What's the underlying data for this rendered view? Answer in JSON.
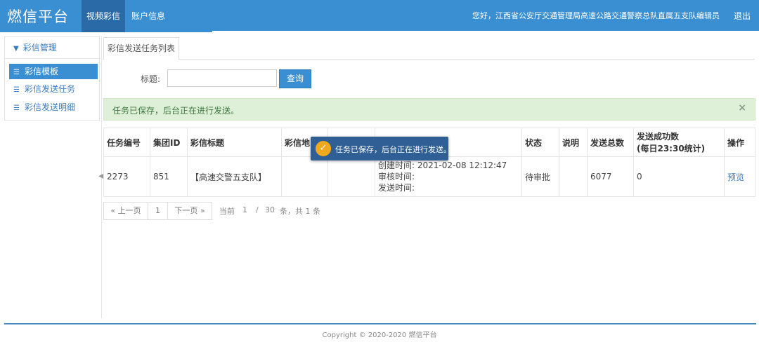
{
  "header": {
    "logo": "燃信平台",
    "nav": [
      {
        "label": "视频彩信",
        "active": true
      },
      {
        "label": "账户信息",
        "active": false
      }
    ],
    "greeting": "您好，江西省公安厅交通管理局高速公路交通警察总队直属五支队编辑员",
    "logout": "退出",
    "colors": {
      "primary": "#3a8fd2",
      "active_tab": "#2a6aa6"
    }
  },
  "sidebar": {
    "section": "彩信管理",
    "items": [
      {
        "label": "彩信模板",
        "active": true,
        "icon": "sitemap-icon"
      },
      {
        "label": "彩信发送任务",
        "active": false,
        "icon": "sitemap-icon"
      },
      {
        "label": "彩信发送明细",
        "active": false,
        "icon": "sitemap-icon"
      }
    ]
  },
  "tabs": [
    {
      "label": "彩信发送任务列表"
    }
  ],
  "search": {
    "label": "标题:",
    "value": "",
    "button": "查询"
  },
  "alert": {
    "text": "任务已保存，后台正在进行发送。",
    "close": "×"
  },
  "toast": {
    "text": "任务已保存，后台正在进行发送。",
    "icon": "check-circle-icon"
  },
  "table": {
    "headers": [
      "任务编号",
      "集团ID",
      "彩信标题",
      "彩信地",
      "",
      "",
      "状态",
      "说明",
      "发送总数",
      "发送成功数",
      "(每日23:30统计)",
      "操作"
    ],
    "rows": [
      {
        "task_no": "2273",
        "group_id": "851",
        "title": "【高速交警五支队】",
        "address": "",
        "blank": "",
        "created": "创建时间:  2021-02-08 12:12:47",
        "reviewed": "审核时间:",
        "sent": "发送时间:",
        "status": "待审批",
        "note": "",
        "total": "6077",
        "success": "0",
        "action": "预览"
      }
    ]
  },
  "pager": {
    "prev": "« 上一页",
    "current": "1",
    "next": "下一页 »",
    "label_current": "当前",
    "page": "1",
    "sep": "/",
    "total_pages": "30",
    "suffix": "条，共 1 条"
  },
  "footer": {
    "copyright": "Copyright © 2020-2020 燃信平台"
  }
}
